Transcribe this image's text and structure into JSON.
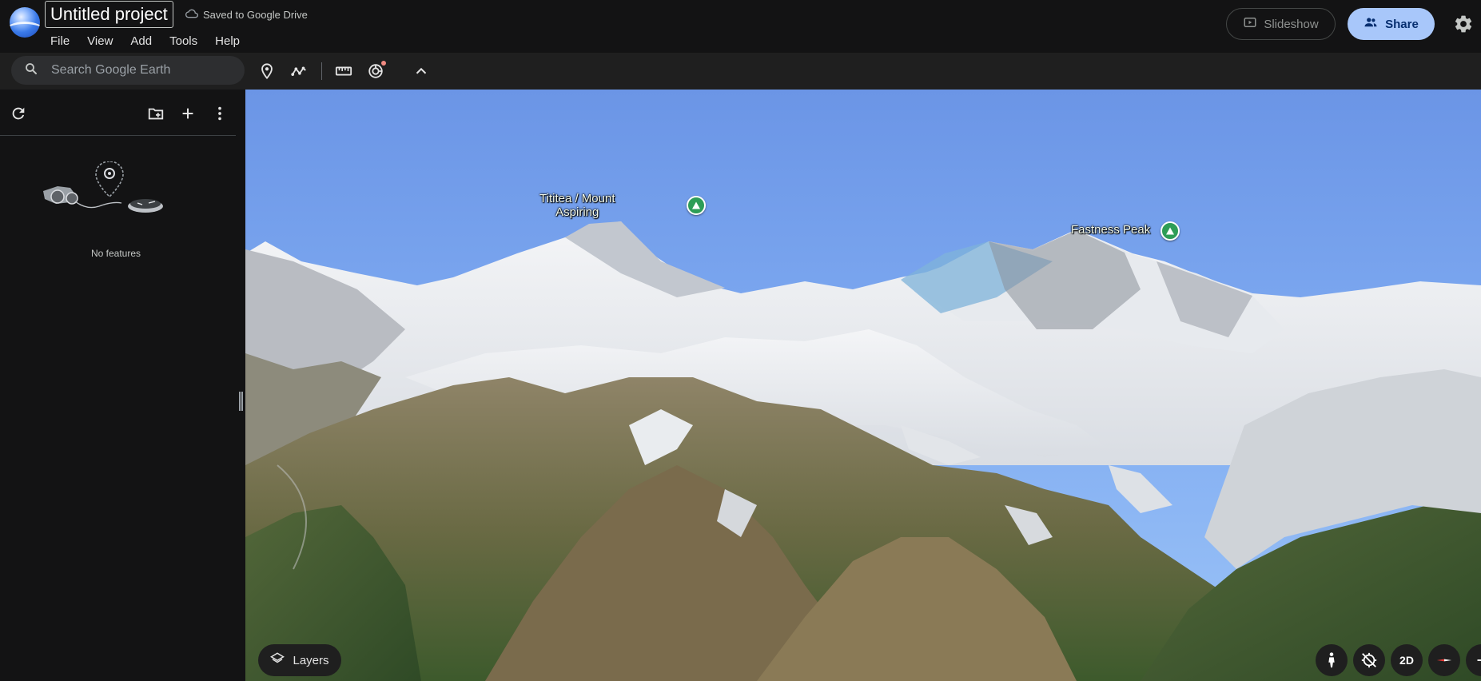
{
  "app": {
    "project_title": "Untitled project",
    "save_status": "Saved to Google Drive",
    "logo_icon": "google-earth-logo-icon"
  },
  "menu": {
    "items": [
      "File",
      "View",
      "Add",
      "Tools",
      "Help"
    ]
  },
  "header_actions": {
    "slideshow_label": "Slideshow",
    "share_label": "Share",
    "settings_icon": "gear-icon",
    "accent_color": "#a8c7fa"
  },
  "toolbar": {
    "search_placeholder": "Search Google Earth",
    "search_value": "",
    "tools": [
      "add-placemark-icon",
      "draw-path-icon",
      "measure-icon",
      "voyager-icon",
      "chevron-up-icon"
    ]
  },
  "panel": {
    "actions": [
      "refresh-icon",
      "new-folder-icon",
      "add-icon",
      "more-vert-icon"
    ],
    "empty_message": "No features"
  },
  "map": {
    "labels": [
      {
        "name": "Tititea / Mount\nAspiring",
        "line1": "Tititea / Mount",
        "line2": "Aspiring"
      },
      {
        "name": "Fastness Peak"
      }
    ],
    "layers_label": "Layers",
    "view_mode_label": "2D",
    "controls": [
      "street-view-pegman-icon",
      "tilt-lock-icon",
      "2d-toggle",
      "compass-icon",
      "zoom-out-icon"
    ]
  }
}
